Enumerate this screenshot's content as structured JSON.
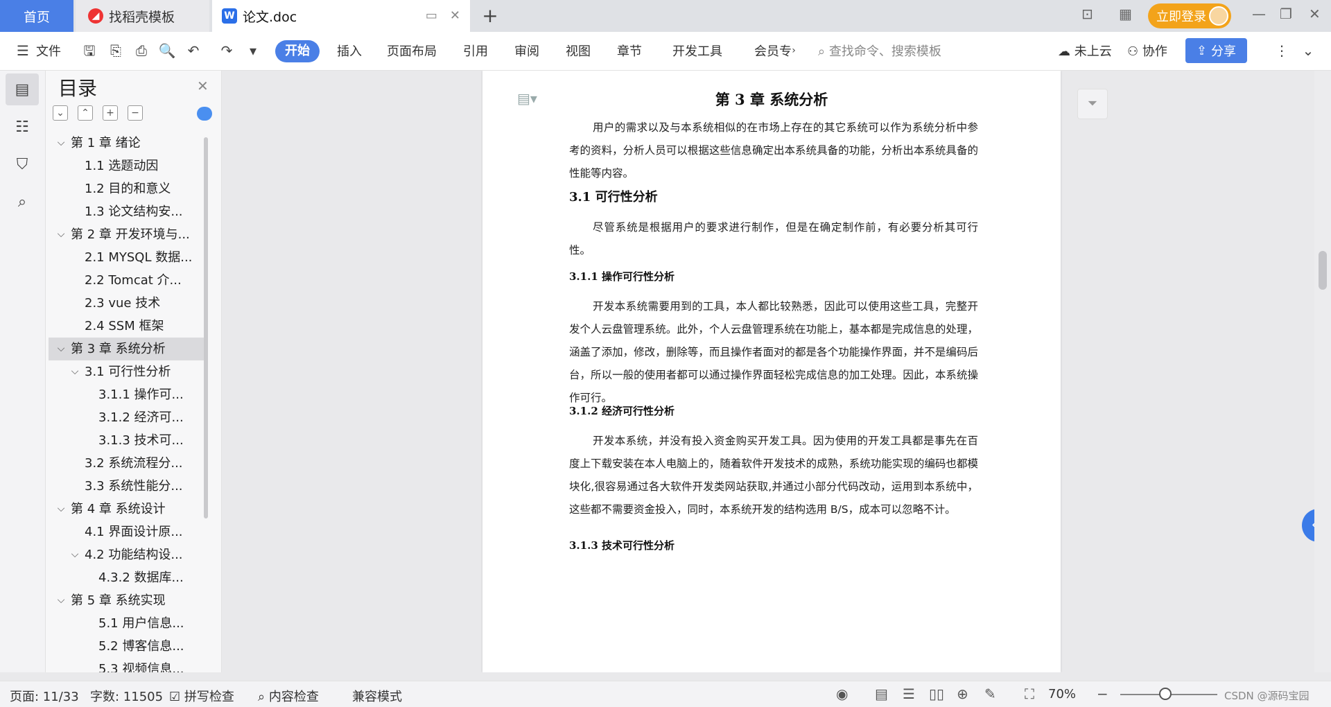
{
  "tabs": {
    "home": "首页",
    "templates": "找稻壳模板",
    "document": "论文.doc",
    "login": "立即登录"
  },
  "toolbar": {
    "file": "文件",
    "menus": [
      "开始",
      "插入",
      "页面布局",
      "引用",
      "审阅",
      "视图",
      "章节",
      "开发工具",
      "会员专"
    ],
    "search_placeholder": "查找命令、搜索模板",
    "cloud": "未上云",
    "collab": "协作",
    "share": "分享"
  },
  "toc": {
    "title": "目录",
    "items": [
      {
        "label": "第 1 章  绪论",
        "level": 0,
        "expanded": true
      },
      {
        "label": "1.1 选题动因",
        "level": 1
      },
      {
        "label": "1.2 目的和意义",
        "level": 1
      },
      {
        "label": "1.3 论文结构安...",
        "level": 1
      },
      {
        "label": "第 2 章  开发环境与...",
        "level": 0,
        "expanded": true
      },
      {
        "label": "2.1 MYSQL 数据...",
        "level": 1
      },
      {
        "label": "2.2 Tomcat  介...",
        "level": 1
      },
      {
        "label": "2.3 vue 技术",
        "level": 1
      },
      {
        "label": "2.4 SSM 框架",
        "level": 1
      },
      {
        "label": "第 3 章  系统分析",
        "level": 0,
        "expanded": true,
        "selected": true
      },
      {
        "label": "3.1 可行性分析",
        "level": 1,
        "expanded": true
      },
      {
        "label": "3.1.1 操作可...",
        "level": 2
      },
      {
        "label": "3.1.2 经济可...",
        "level": 2
      },
      {
        "label": "3.1.3 技术可...",
        "level": 2
      },
      {
        "label": "3.2 系统流程分...",
        "level": 1
      },
      {
        "label": "3.3 系统性能分...",
        "level": 1
      },
      {
        "label": "第 4 章  系统设计",
        "level": 0,
        "expanded": true
      },
      {
        "label": "4.1 界面设计原...",
        "level": 1
      },
      {
        "label": "4.2 功能结构设...",
        "level": 1,
        "expanded": true
      },
      {
        "label": "4.3.2  数据库...",
        "level": 2
      },
      {
        "label": "第 5 章  系统实现",
        "level": 0,
        "expanded": true
      },
      {
        "label": "5.1 用户信息...",
        "level": 2
      },
      {
        "label": "5.2  博客信息...",
        "level": 2
      },
      {
        "label": "5.3 视频信息...",
        "level": 2
      }
    ]
  },
  "document": {
    "chapter_title": "第 3 章  系统分析",
    "intro": "用户的需求以及与本系统相似的在市场上存在的其它系统可以作为系统分析中参考的资料，分析人员可以根据这些信息确定出本系统具备的功能，分析出本系统具备的性能等内容。",
    "sec_3_1": "3.1 可行性分析",
    "sec_3_1_text": "尽管系统是根据用户的要求进行制作，但是在确定制作前，有必要分析其可行性。",
    "sec_3_1_1": "3.1.1 操作可行性分析",
    "sec_3_1_1_text": "开发本系统需要用到的工具，本人都比较熟悉，因此可以使用这些工具，完整开发个人云盘管理系统。此外，个人云盘管理系统在功能上，基本都是完成信息的处理，涵盖了添加，修改，删除等，而且操作者面对的都是各个功能操作界面，并不是编码后台，所以一般的使用者都可以通过操作界面轻松完成信息的加工处理。因此，本系统操作可行。",
    "sec_3_1_2": "3.1.2 经济可行性分析",
    "sec_3_1_2_text": "开发本系统，并没有投入资金购买开发工具。因为使用的开发工具都是事先在百度上下载安装在本人电脑上的，随着软件开发技术的成熟，系统功能实现的编码也都模块化,很容易通过各大软件开发类网站获取,并通过小部分代码改动，运用到本系统中，这些都不需要资金投入，同时，本系统开发的结构选用 B/S，成本可以忽略不计。",
    "sec_3_1_3": "3.1.3 技术可行性分析"
  },
  "status": {
    "page": "页面: 11/33",
    "words": "字数: 11505",
    "spellcheck": "拼写检查",
    "content_check": "内容检查",
    "compat": "兼容模式",
    "zoom": "70%",
    "watermark": "CSDN @源码宝园"
  },
  "colors": {
    "accent": "#4a7fe6",
    "login": "#f3a31a"
  }
}
